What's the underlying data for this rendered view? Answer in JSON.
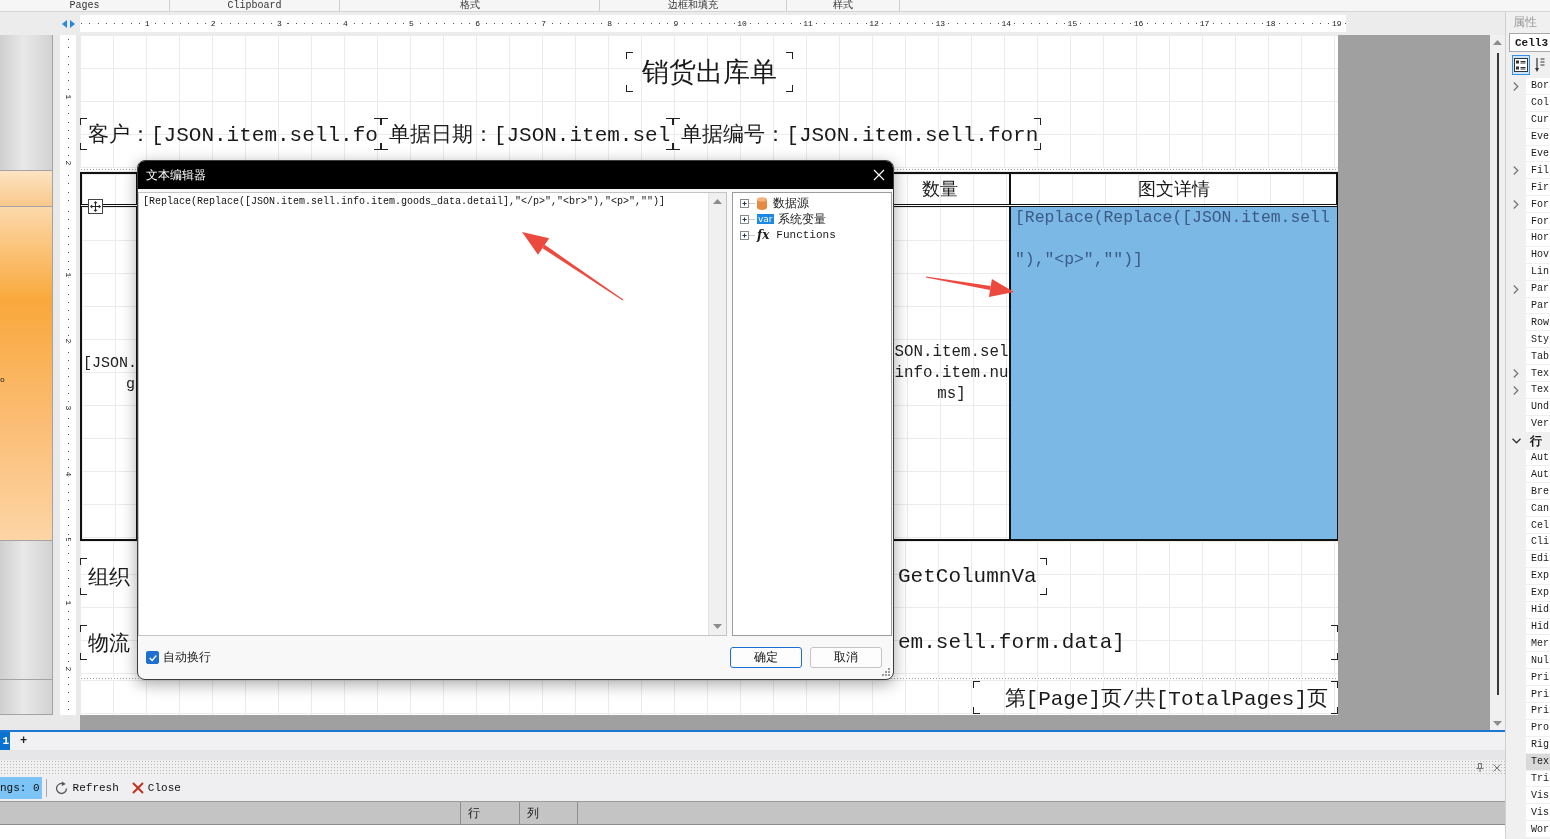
{
  "ribbon_groups": [
    {
      "label": "Pages"
    },
    {
      "label": "Clipboard"
    },
    {
      "label": "格式"
    },
    {
      "label": "边框和填充"
    },
    {
      "label": "样式"
    }
  ],
  "horizontal_ruler": [
    "1",
    "2",
    "3",
    "4",
    "5",
    "6",
    "7",
    "8",
    "9",
    "10",
    "11",
    "12",
    "13",
    "14",
    "15",
    "16",
    "17",
    "18",
    "19"
  ],
  "vertical_ruler": {
    "title_band": [
      "1",
      "2"
    ],
    "data_band": [
      "1",
      "2",
      "3",
      "4",
      "5"
    ],
    "summary_band": [
      "1",
      "2"
    ]
  },
  "band_strip": {
    "fragment": "o"
  },
  "report": {
    "title": "销货出库单",
    "header_fields": [
      {
        "text": "客户：[JSON.item.sell.fo"
      },
      {
        "text": "单据日期：[JSON.item.sel"
      },
      {
        "text": "单据编号：[JSON.item.sell.forn"
      }
    ],
    "table": {
      "columns": [
        {
          "label": "数量"
        },
        {
          "label": "图文详情"
        }
      ],
      "cells": [
        {
          "lines": [
            "[JSON.",
            "g"
          ],
          "selected": false
        },
        {
          "lines": [
            "SON.item.sel",
            "info.item.nu",
            "ms]"
          ],
          "selected": false
        },
        {
          "lines": [
            "[Replace(Replace([JSON.item.sell",
            "\"),\"<p>\",\"\")]"
          ],
          "selected": true
        }
      ]
    },
    "summary_rows": [
      {
        "left_text": "组织",
        "right_text": "GetColumnVa"
      },
      {
        "left_text": "物流",
        "right_text": "em.sell.form.data]"
      }
    ],
    "page_footer": "第[Page]页/共[TotalPages]页"
  },
  "dialog": {
    "title": "文本编辑器",
    "expression": "[Replace(Replace([JSON.item.sell.info.item.goods_data.detail],\"</p>\",\"<br>\"),\"<p>\",\"\")]",
    "tree": [
      {
        "label": "数据源",
        "kind": "datasource",
        "expanded": false
      },
      {
        "label": "系统变量",
        "kind": "variables",
        "icon_text": "var",
        "expanded": false
      },
      {
        "label": "Functions",
        "kind": "functions",
        "icon_text": "fx",
        "expanded": false
      }
    ],
    "word_wrap": {
      "label": "自动换行",
      "checked": true
    },
    "buttons": [
      {
        "label": "确定",
        "default": true
      },
      {
        "label": "取消",
        "default": false
      }
    ]
  },
  "page_tabs": [
    {
      "label": "1",
      "selected": true
    }
  ],
  "add_tab": "+",
  "output_panel": {
    "counter": {
      "label": "ngs: 0",
      "on": true
    },
    "actions": [
      {
        "kind": "refresh",
        "label": "Refresh"
      },
      {
        "kind": "close",
        "label": "Close"
      }
    ]
  },
  "status_bar": {
    "cells": [
      "行",
      "列"
    ]
  },
  "properties": {
    "title": "属性",
    "object": "Cell3",
    "view_buttons": [
      {
        "kind": "categorized",
        "selected": true
      },
      {
        "kind": "alphabetical",
        "selected": false
      }
    ],
    "rows": [
      {
        "name": "Bor",
        "kind": "group",
        "expanded": false,
        "selected": false
      },
      {
        "name": "Col",
        "kind": "property",
        "selected": false
      },
      {
        "name": "Cur",
        "kind": "property",
        "selected": false
      },
      {
        "name": "Eve",
        "kind": "property",
        "selected": false
      },
      {
        "name": "Eve",
        "kind": "property",
        "selected": false
      },
      {
        "name": "Fil",
        "kind": "group",
        "expanded": false,
        "selected": false
      },
      {
        "name": "Fir",
        "kind": "property",
        "selected": false
      },
      {
        "name": "For",
        "kind": "group",
        "expanded": false,
        "selected": false
      },
      {
        "name": "For",
        "kind": "property",
        "selected": false
      },
      {
        "name": "Hor",
        "kind": "property",
        "selected": false
      },
      {
        "name": "Hov",
        "kind": "property",
        "selected": false
      },
      {
        "name": "Lin",
        "kind": "property",
        "selected": false
      },
      {
        "name": "Par",
        "kind": "group",
        "expanded": false,
        "selected": false
      },
      {
        "name": "Par",
        "kind": "property",
        "selected": false
      },
      {
        "name": "Row",
        "kind": "property",
        "selected": false
      },
      {
        "name": "Sty",
        "kind": "property",
        "selected": false
      },
      {
        "name": "Tab",
        "kind": "property",
        "selected": false
      },
      {
        "name": "Tex",
        "kind": "group",
        "expanded": false,
        "selected": false
      },
      {
        "name": "Tex",
        "kind": "group",
        "expanded": false,
        "selected": false
      },
      {
        "name": "Und",
        "kind": "property",
        "selected": false
      },
      {
        "name": "Ver",
        "kind": "property",
        "selected": false
      },
      {
        "name": "行",
        "kind": "category",
        "expanded": true,
        "selected": false
      },
      {
        "name": "Aut",
        "kind": "property",
        "selected": false
      },
      {
        "name": "Aut",
        "kind": "property",
        "selected": false
      },
      {
        "name": "Bre",
        "kind": "property",
        "selected": false
      },
      {
        "name": "Can",
        "kind": "property",
        "selected": false
      },
      {
        "name": "Cel",
        "kind": "property",
        "selected": false
      },
      {
        "name": "Cli",
        "kind": "property",
        "selected": false
      },
      {
        "name": "Edi",
        "kind": "property",
        "selected": false
      },
      {
        "name": "Exp",
        "kind": "property",
        "selected": false
      },
      {
        "name": "Exp",
        "kind": "property",
        "selected": false
      },
      {
        "name": "Hid",
        "kind": "property",
        "selected": false
      },
      {
        "name": "Hid",
        "kind": "property",
        "selected": false
      },
      {
        "name": "Mer",
        "kind": "property",
        "selected": false
      },
      {
        "name": "Nul",
        "kind": "property",
        "selected": false
      },
      {
        "name": "Pri",
        "kind": "property",
        "selected": false
      },
      {
        "name": "Pri",
        "kind": "property",
        "selected": false
      },
      {
        "name": "Pri",
        "kind": "property",
        "selected": false
      },
      {
        "name": "Pro",
        "kind": "property",
        "selected": false
      },
      {
        "name": "Rig",
        "kind": "property",
        "selected": false
      },
      {
        "name": "Tex",
        "kind": "property",
        "selected": true
      },
      {
        "name": "Tri",
        "kind": "property",
        "selected": false
      },
      {
        "name": "Vis",
        "kind": "property",
        "selected": false
      },
      {
        "name": "Vis",
        "kind": "property",
        "selected": false
      },
      {
        "name": "Wor",
        "kind": "property",
        "selected": false
      }
    ]
  }
}
